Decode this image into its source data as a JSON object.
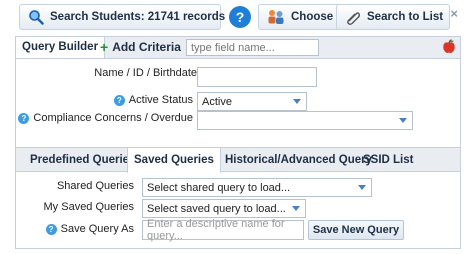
{
  "toolbar": {
    "search_label": "Search Students: 21741 records",
    "help_label": "?",
    "choose_label": "Choose Student",
    "list_label": "Search to List",
    "close_label": "×"
  },
  "query_builder": {
    "tab_label": "Query Builder",
    "add_criteria_label": "Add Criteria",
    "field_placeholder": "type field name...",
    "name_label": "Name / ID / Birthdate",
    "name_value": "",
    "active_status_label": "Active Status",
    "active_status_value": "Active",
    "compliance_label": "Compliance Concerns / Overdue",
    "compliance_value": ""
  },
  "queries": {
    "tabs": [
      {
        "label": "Predefined Queries"
      },
      {
        "label": "Saved Queries"
      },
      {
        "label": "Historical/Advanced Query"
      },
      {
        "label": "SSID List"
      }
    ],
    "active_tab": "Saved Queries",
    "shared_label": "Shared Queries",
    "shared_value": "Select shared query to load...",
    "my_label": "My Saved Queries",
    "my_value": "Select saved query to load...",
    "save_as_label": "Save Query As",
    "save_as_placeholder": "Enter a descriptive name for query...",
    "save_button_label": "Save New Query"
  },
  "colors": {
    "accent": "#1f7fd6",
    "header_bg": "#e9edf2",
    "help_icon": "#3d9de0"
  }
}
